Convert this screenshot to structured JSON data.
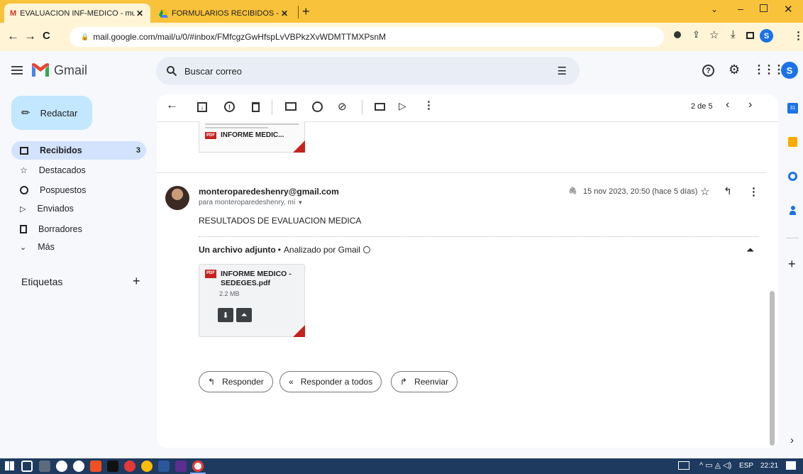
{
  "browser": {
    "tabs": [
      {
        "title": "EVALUACION INF-MEDICO - mu",
        "active": true
      },
      {
        "title": "FORMULARIOS RECIBIDOS - Go",
        "active": false
      }
    ],
    "new_tab": "+",
    "url": "mail.google.com/mail/u/0/#inbox/FMfcgzGwHfspLvVBPkzXvWDMTTMXPsnM",
    "profile_initial": "S"
  },
  "gmail": {
    "brand": "Gmail",
    "search_placeholder": "Buscar correo",
    "account_initial": "S",
    "compose": "Redactar",
    "nav": [
      {
        "label": "Recibidos",
        "count": "3",
        "icon": "inbox-icon"
      },
      {
        "label": "Destacados",
        "count": "",
        "icon": "star-icon"
      },
      {
        "label": "Pospuestos",
        "count": "",
        "icon": "clock-icon"
      },
      {
        "label": "Enviados",
        "count": "",
        "icon": "send-icon"
      },
      {
        "label": "Borradores",
        "count": "",
        "icon": "draft-icon"
      },
      {
        "label": "Más",
        "count": "",
        "icon": "chevron-down-icon"
      }
    ],
    "labels_heading": "Etiquetas",
    "labels_add": "+"
  },
  "thread": {
    "pager": "2 de 5",
    "prev_attachment": "INFORME MEDIC...",
    "message": {
      "sender": "monteroparedeshenry@gmail.com",
      "to": "para monteroparedeshenry, mí",
      "date": "15 nov 2023, 20:50 (hace 5 días)",
      "body": "RESULTADOS DE EVALUACION MEDICA",
      "attach_heading": "Un archivo adjunto",
      "attach_sep": "•",
      "scanned": "Analizado por Gmail",
      "attachment": {
        "name": "INFORME MEDICO - SEDEGES.pdf",
        "size": "2.2 MB",
        "type": "PDF"
      }
    },
    "actions": {
      "reply": "Responder",
      "reply_all": "Responder a todos",
      "forward": "Reenviar"
    }
  },
  "taskbar": {
    "lang": "ESP",
    "time": "22:21"
  },
  "colors": {
    "chrome_tab": "#f9c23b",
    "compose": "#c2e7ff",
    "selected_nav": "#d3e3fd",
    "pdf_red": "#c5221f",
    "taskbar": "#1e3a5f"
  }
}
